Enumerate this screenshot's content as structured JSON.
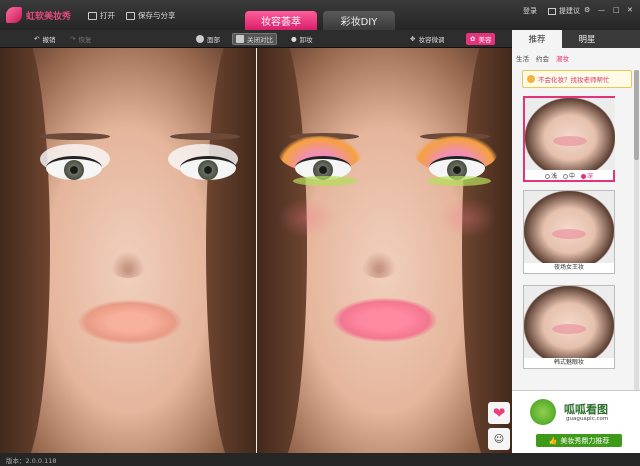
{
  "app": {
    "title": "虹软美妆秀"
  },
  "titlebar": {
    "open_label": "打开",
    "save_share_label": "保存与分享",
    "tabs": [
      {
        "label": "妆容荟萃"
      },
      {
        "label": "彩妆DIY"
      }
    ],
    "login_label": "登录",
    "feedback_label": "提建议"
  },
  "toolbar": {
    "undo_label": "撤销",
    "redo_label": "恢复",
    "face_label": "面部",
    "compare_label": "关闭对比",
    "remove_label": "卸妆",
    "adjust_label": "妆容微调",
    "beauty_label": "美容"
  },
  "panel": {
    "tabs": [
      {
        "label": "推荐"
      },
      {
        "label": "明星"
      }
    ],
    "subtabs": [
      {
        "label": "生活"
      },
      {
        "label": "约会"
      },
      {
        "label": "潮妆"
      }
    ],
    "hint": "不会化妆？找妆老师帮忙",
    "levels": [
      {
        "label": "浅"
      },
      {
        "label": "中"
      },
      {
        "label": "深"
      }
    ],
    "selected_level": "深",
    "thumbs": [
      {
        "caption": ""
      },
      {
        "caption": "夜场女王妆"
      },
      {
        "caption": "韩式魅眼妆"
      }
    ]
  },
  "ad": {
    "title": "呱呱看图",
    "url": "guaguapic.com",
    "button": "美妆秀鼎力推荐"
  },
  "status": {
    "version": "版本：2.0.0.118"
  },
  "colors": {
    "accent": "#e3337a",
    "eyeshadow_left": "#ffffff",
    "eyeshadow_right_top": "#f5a040",
    "eyeshadow_right_mid": "#ef8fb5",
    "eyeshadow_right_low": "#b4e05a"
  }
}
